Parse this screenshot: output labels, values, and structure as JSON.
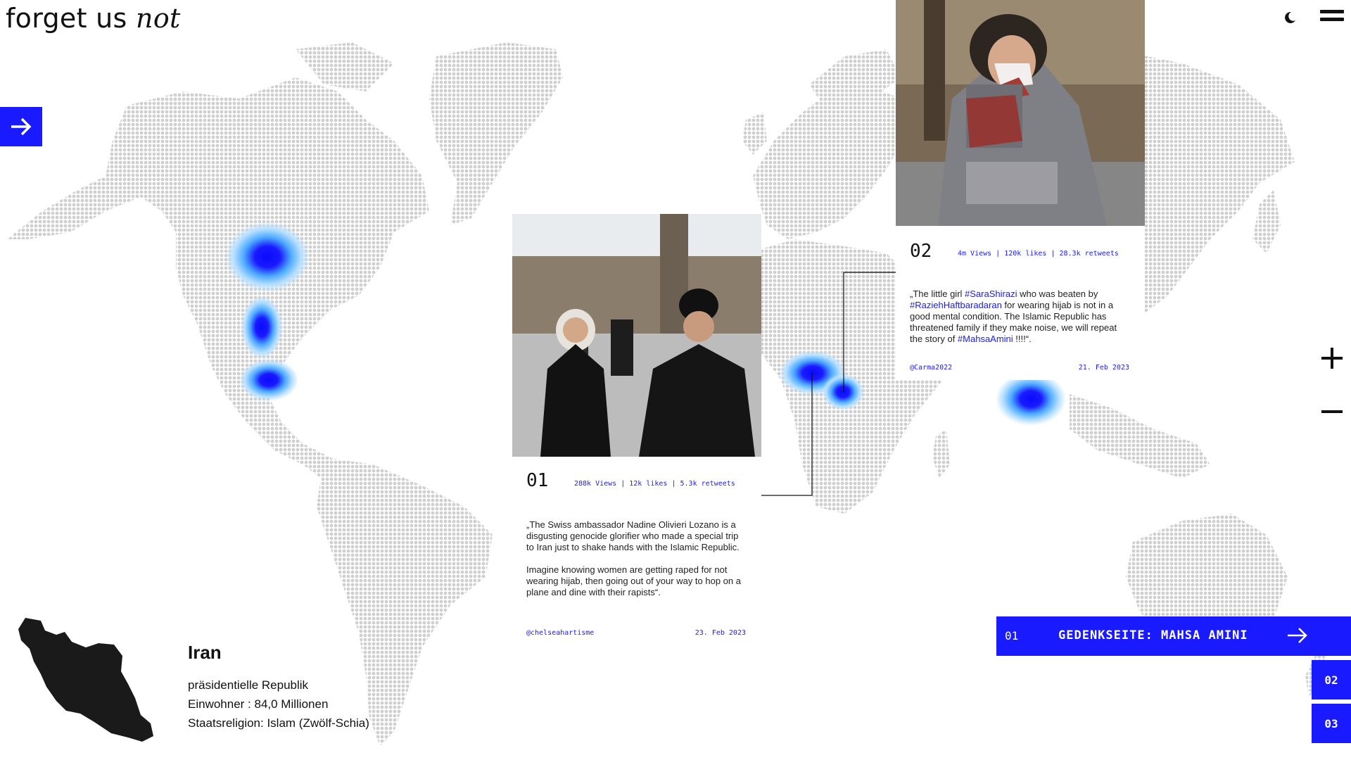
{
  "app": {
    "logo_main": "forget us",
    "logo_italic": "not"
  },
  "colors": {
    "accent": "#1a1aff",
    "map_land": "#d3d3d3",
    "heat_low": "#b8e0ff",
    "heat_mid": "#4aa8ff",
    "heat_high": "#1a1aff"
  },
  "icons": {
    "theme": "moon-icon",
    "menu": "menu-icon",
    "next": "arrow-right-icon",
    "zoom_in": "plus-icon",
    "zoom_out": "minus-icon"
  },
  "posts": [
    {
      "number": "01",
      "stats": "288k Views | 12k likes | 5.3k retweets",
      "quote_p1": "„The Swiss ambassador Nadine Olivieri Lozano is a disgusting genocide glorifier who made a special trip to Iran just to shake hands with the Islamic Republic.",
      "quote_p2": "Imagine knowing women are getting raped for not wearing hijab, then going out of your way to hop on a plane and dine with their rapists“.",
      "handle": "@chelseahartisme",
      "date": "23. Feb 2023"
    },
    {
      "number": "02",
      "stats": "4m Views | 120k likes | 28.3k retweets",
      "quote_a": "„The little girl ",
      "tag1": "#SaraShirazi",
      "quote_b": " who was beaten by ",
      "tag2": "#RaziehHaftbaradaran",
      "quote_c": " for wearing hijab is not in a good mental condition. The Islamic Republic has threatened family if they make noise, we will repeat the story of ",
      "tag3": "#MahsaAmini",
      "quote_d": " !!!!“.",
      "handle": "@Carma2022",
      "date": "21. Feb 2023"
    }
  ],
  "country": {
    "name": "Iran",
    "government": "präsidentielle Republik",
    "population": "Einwohner : 84,0 Millionen",
    "religion": "Staatsreligion: Islam (Zwölf-Schia)"
  },
  "memorials": {
    "main_number": "01",
    "main_label": "GEDENKSEITE: MAHSA AMINI",
    "items": [
      "02",
      "03"
    ]
  }
}
